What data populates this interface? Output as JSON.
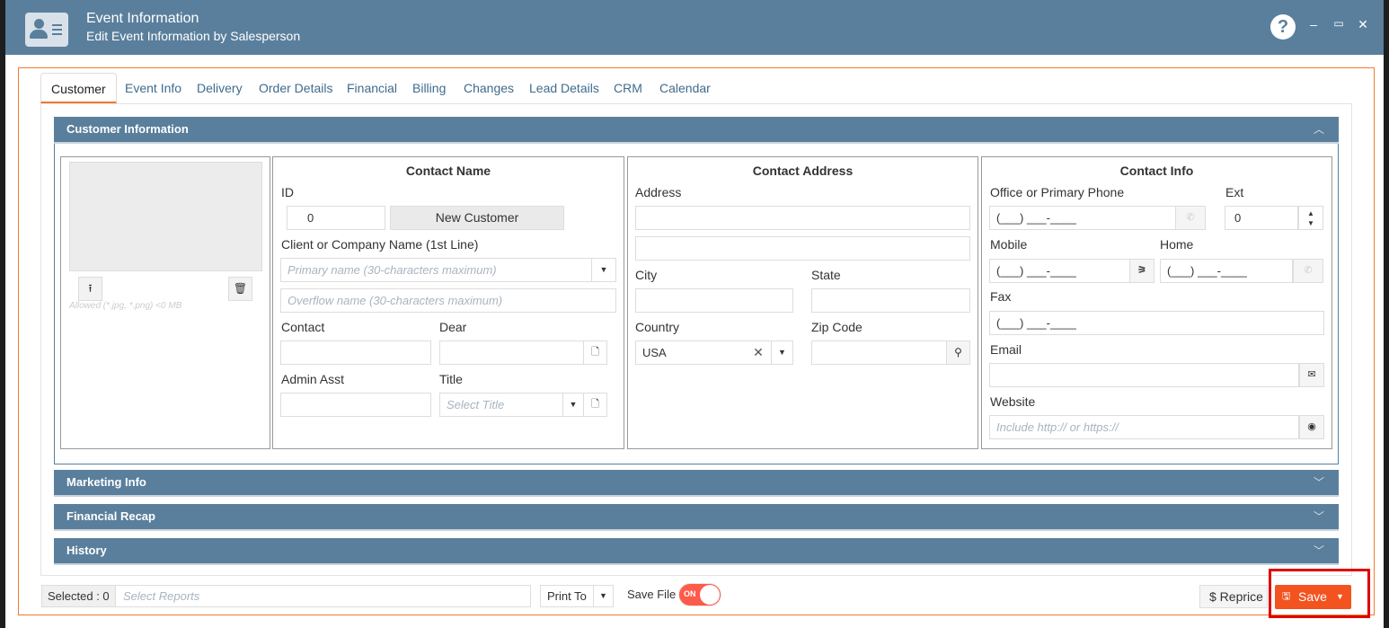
{
  "window": {
    "title": "Event Information",
    "subtitle": "Edit Event Information by Salesperson",
    "help": "?",
    "minimize": "–",
    "maximize": "▭",
    "close": "✕"
  },
  "tabs": [
    "Customer",
    "Event Info",
    "Delivery",
    "Order Details",
    "Financial",
    "Billing",
    "Changes",
    "Lead Details",
    "CRM",
    "Calendar"
  ],
  "active_tab": "Customer",
  "sections": {
    "customer_info": "Customer Information",
    "marketing": "Marketing Info",
    "financial_recap": "Financial Recap",
    "history": "History"
  },
  "photo": {
    "upload_icon": "upload-icon",
    "delete_icon": "trash-icon",
    "note": "Allowed (*.jpg, *.png) <0 MB"
  },
  "contact_name": {
    "heading": "Contact Name",
    "id_label": "ID",
    "id_value": "0",
    "new_customer": "New Customer",
    "company_label": "Client or Company Name (1st Line)",
    "primary_placeholder": "Primary name (30-characters maximum)",
    "overflow_placeholder": "Overflow name (30-characters maximum)",
    "contact_label": "Contact",
    "dear_label": "Dear",
    "admin_label": "Admin Asst",
    "title_label": "Title",
    "title_placeholder": "Select Title"
  },
  "contact_address": {
    "heading": "Contact Address",
    "address_label": "Address",
    "city_label": "City",
    "state_label": "State",
    "country_label": "Country",
    "country_value": "USA",
    "zip_label": "Zip Code"
  },
  "contact_info": {
    "heading": "Contact Info",
    "phone_label": "Office or Primary Phone",
    "phone_mask": "(___) ___-____",
    "ext_label": "Ext",
    "ext_value": "0",
    "mobile_label": "Mobile",
    "mobile_mask": "(___) ___-____",
    "home_label": "Home",
    "home_mask": "(___) ___-____",
    "fax_label": "Fax",
    "fax_mask": "(___) ___-____",
    "email_label": "Email",
    "website_label": "Website",
    "website_placeholder": "Include http:// or https://"
  },
  "footer": {
    "selected": "Selected : 0",
    "select_reports": "Select Reports",
    "print_to": "Print To",
    "save_file": "Save File",
    "toggle_state": "ON",
    "reprice": "$  Reprice",
    "save": "Save"
  },
  "colors": {
    "header": "#5a7f9c",
    "accent": "#f07a30",
    "save": "#f2531f",
    "highlight": "#e00000"
  }
}
